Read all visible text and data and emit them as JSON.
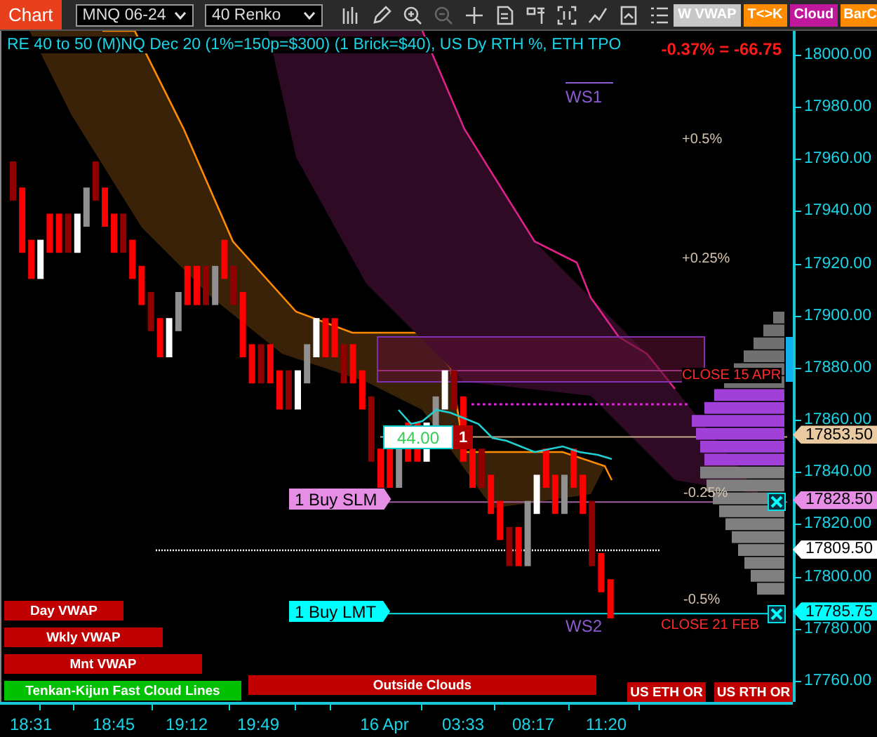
{
  "toolbar": {
    "chart_button": "Chart",
    "instrument": "MNQ 06-24",
    "bar_type": "40 Renko",
    "toggles": [
      {
        "label": "W VWAP",
        "color": "#c8c8c8"
      },
      {
        "label": "T<>K",
        "color": "#ff8c00"
      },
      {
        "label": "Cloud",
        "color": "#c0189a"
      },
      {
        "label": "BarC",
        "color": "#ff8c00"
      }
    ]
  },
  "chart": {
    "title": "RE 40 to 50 (M)NQ Dec 20 (1%=150p=$300) (1 Brick=$40), US Dy RTH %, ETH TPO",
    "change": "-0.37% = -66.75",
    "labels": [
      {
        "kind": "pivot",
        "text": "WS1"
      },
      {
        "kind": "level",
        "text": "+0.5%"
      },
      {
        "kind": "level",
        "text": "+0.25%"
      },
      {
        "kind": "close",
        "text": "CLOSE 15 APR"
      },
      {
        "kind": "level",
        "text": "-0.25%"
      },
      {
        "kind": "level",
        "text": "-0.5%"
      },
      {
        "kind": "pivot",
        "text": "WS2"
      },
      {
        "kind": "close",
        "text": "CLOSE 21 FEB"
      }
    ],
    "quantity_box": {
      "price": "44.00",
      "count": "1"
    },
    "orders": [
      {
        "label": "1 Buy SLM",
        "color": "#e68de6"
      },
      {
        "label": "1 Buy LMT",
        "color": "#00ffff"
      }
    ],
    "indicator_buttons": [
      {
        "label": "Day VWAP",
        "color": "#c00000"
      },
      {
        "label": "Wkly VWAP",
        "color": "#c00000"
      },
      {
        "label": "Mnt VWAP",
        "color": "#c00000"
      },
      {
        "label": "Tenkan-Kijun Fast Cloud Lines",
        "color": "#00c000"
      },
      {
        "label": "Outside Clouds",
        "color": "#c00000"
      },
      {
        "label": "US ETH OR",
        "color": "#c00000"
      },
      {
        "label": "US RTH OR",
        "color": "#c00000"
      }
    ]
  },
  "price_axis": {
    "labels": [
      "18000.00",
      "17980.00",
      "17960.00",
      "17940.00",
      "17920.00",
      "17900.00",
      "17880.00",
      "17860.00",
      "17840.00",
      "17820.00",
      "17800.00",
      "17780.00",
      "17760.00"
    ],
    "tags": [
      {
        "text": "17853.50",
        "color": "#e8c9a0"
      },
      {
        "text": "17828.50",
        "color": "#e68de6"
      },
      {
        "text": "17809.50",
        "color": "#ffffff"
      },
      {
        "text": "17785.75",
        "color": "#00ffff"
      }
    ]
  },
  "time_axis": {
    "labels": [
      "18:31",
      "18:45",
      "19:12",
      "19:49",
      "16 Apr",
      "03:33",
      "08:17",
      "11:20"
    ]
  }
}
